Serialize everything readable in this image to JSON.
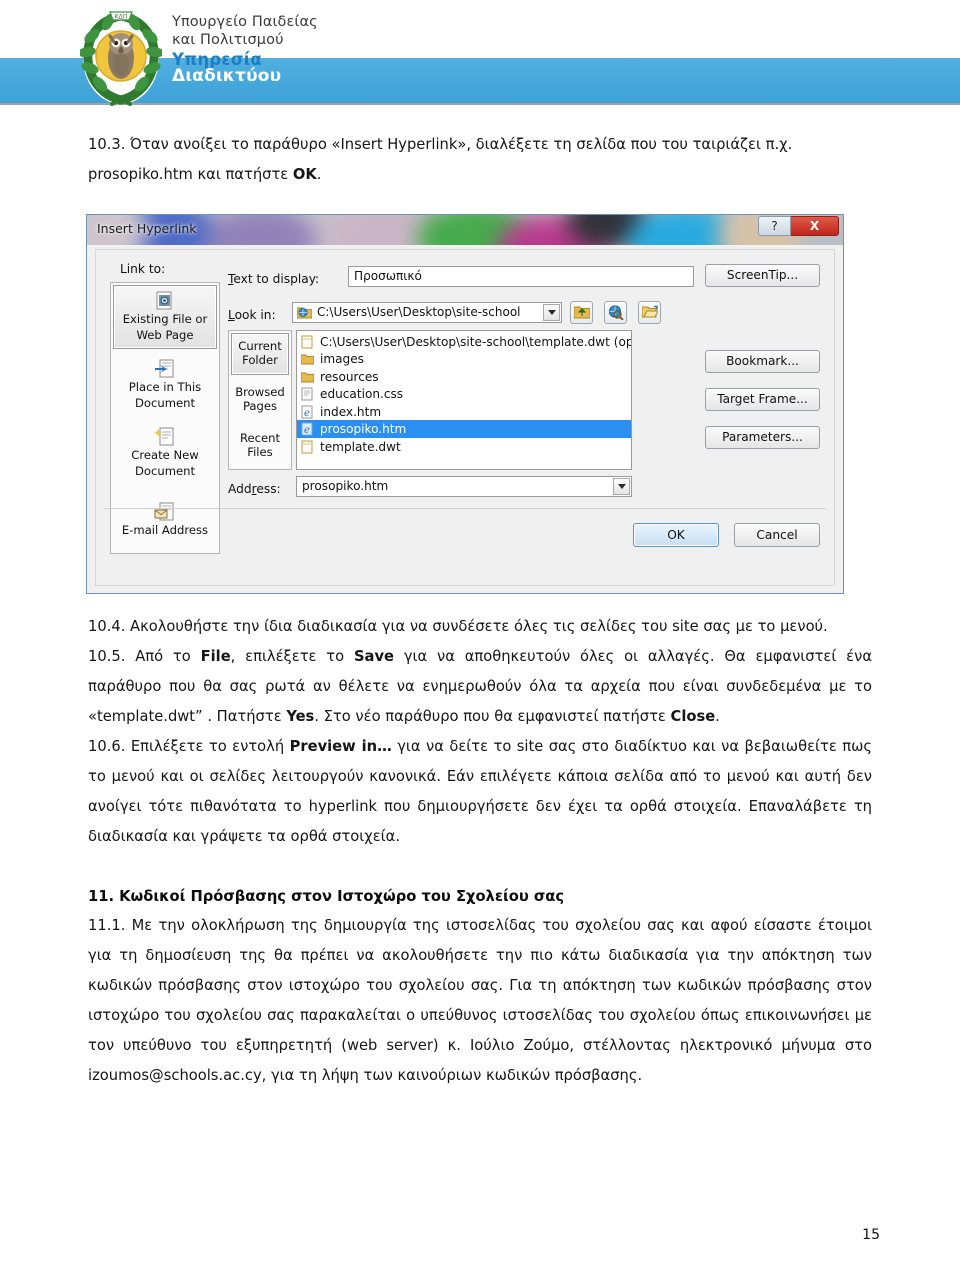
{
  "header": {
    "logo_alt": "ministry-emblem-owl-laurel",
    "line1": "Υπουργείο Παιδείας",
    "line2": "και Πολιτισμού",
    "line3": "Υπηρεσία",
    "line4": "Διαδικτύου",
    "band_color": "#46a8dc",
    "blue_text_color": "#1c7ec4"
  },
  "doc": {
    "step_10_3_a": "10.3. Όταν ανοίξει το παράθυρο «Insert Hyperlink», διαλέξετε τη σελίδα που του ταιριάζει π.χ.",
    "step_10_3_b_pre": "prosopiko.htm και πατήστε ",
    "step_10_3_b_bold": "OK",
    "step_10_3_b_post": ".",
    "step_10_4": "10.4.  Ακολουθήστε την ίδια διαδικασία για να συνδέσετε όλες τις σελίδες του site σας με το μενού.",
    "step_10_5_p1": "10.5. Από το ",
    "step_10_5_b1": "File",
    "step_10_5_p2": ", επιλέξετε το ",
    "step_10_5_b2": "Save",
    "step_10_5_p3": " για να αποθηκευτούν όλες οι αλλαγές. Θα εμφανιστεί ένα παράθυρο που θα σας ρωτά αν θέλετε να ενημερωθούν όλα τα αρχεία που είναι συνδεδεμένα με το «template.dwt” . Πατήστε ",
    "step_10_5_b3": "Yes",
    "step_10_5_p4": ". Στο νέο παράθυρο που θα εμφανιστεί πατήστε ",
    "step_10_5_b4": "Close",
    "step_10_5_p5": ".",
    "step_10_6_p1": "10.6. Επιλέξετε το εντολή ",
    "step_10_6_b1": "Preview in…",
    "step_10_6_p2": " για να δείτε το site σας στο διαδίκτυο και να βεβαιωθείτε πως το μενού και οι σελίδες λειτουργούν κανονικά.   Εάν επιλέγετε κάποια σελίδα από το μενού και αυτή δεν ανοίγει τότε πιθανότατα το hyperlink που δημιουργήσετε δεν έχει τα ορθά στοιχεία. Επαναλάβετε τη διαδικασία  και γράψετε τα ορθά στοιχεία.",
    "heading_11": "11.  Κωδικοί Πρόσβασης στον Ιστοχώρο του Σχολείου σας",
    "para_11_1": "11.1. Με την ολοκλήρωση της δημιουργία της ιστοσελίδας του σχολείου σας και αφού είσαστε έτοιμοι για τη δημοσίευση της θα πρέπει να ακολουθήσετε την πιο κάτω διαδικασία για την απόκτηση των κωδικών πρόσβασης στον ιστοχώρο του σχολείου σας. Για τη απόκτηση των κωδικών πρόσβασης στον ιστοχώρο του σχολείου σας παρακαλείται ο υπεύθυνος ιστοσελίδας του σχολείου όπως επικοινωνήσει με τον υπεύθυνο του εξυπηρετητή (web server) κ. Ιούλιο Ζούμο, στέλλοντας ηλεκτρονικό μήνυμα στο izoumos@schools.ac.cy, για τη λήψη των καινούριων κωδικών πρόσβασης.",
    "page_number": "15"
  },
  "dialog": {
    "title": "Insert Hyperlink",
    "help_button": "?",
    "close_button": "X",
    "link_to_label": "Link to:",
    "rail": [
      {
        "label_line1": "Existing File or",
        "label_line2": "Web Page",
        "icon": "existing-file-icon",
        "selected": true
      },
      {
        "label_line1": "Place in This",
        "label_line2": "Document",
        "icon": "place-in-document-icon",
        "selected": false
      },
      {
        "label_line1": "Create New",
        "label_line2": "Document",
        "icon": "create-new-document-icon",
        "selected": false
      },
      {
        "label_line1": "E-mail Address",
        "label_line2": "",
        "icon": "email-address-icon",
        "selected": false
      }
    ],
    "text_to_display_label": "Text to display:",
    "text_to_display_value": "Προσωπικό",
    "look_in_label": "Look in:",
    "look_in_value": "C:\\Users\\User\\Desktop\\site-school",
    "toolbar_icons": [
      "up-one-folder-icon",
      "browse-web-icon",
      "browse-file-icon"
    ],
    "stack": [
      {
        "label_line1": "Current",
        "label_line2": "Folder",
        "selected": true
      },
      {
        "label_line1": "Browsed",
        "label_line2": "Pages",
        "selected": false
      },
      {
        "label_line1": "Recent",
        "label_line2": "Files",
        "selected": false
      }
    ],
    "files": [
      {
        "name": "C:\\Users\\User\\Desktop\\site-school\\template.dwt (open)",
        "icon": "document-icon",
        "selected": false
      },
      {
        "name": "images",
        "icon": "folder-icon",
        "selected": false
      },
      {
        "name": "resources",
        "icon": "folder-icon",
        "selected": false
      },
      {
        "name": "education.css",
        "icon": "css-file-icon",
        "selected": false
      },
      {
        "name": "index.htm",
        "icon": "ie-html-icon",
        "selected": false
      },
      {
        "name": "prosopiko.htm",
        "icon": "ie-html-icon",
        "selected": true
      },
      {
        "name": "template.dwt",
        "icon": "document-icon",
        "selected": false
      }
    ],
    "address_label": "Address:",
    "address_value": "prosopiko.htm",
    "screentip_button": "ScreenTip...",
    "bookmark_button": "Bookmark...",
    "target_frame_button": "Target Frame...",
    "parameters_button": "Parameters...",
    "ok_button": "OK",
    "cancel_button": "Cancel",
    "selection_color": "#2a8ff0"
  }
}
